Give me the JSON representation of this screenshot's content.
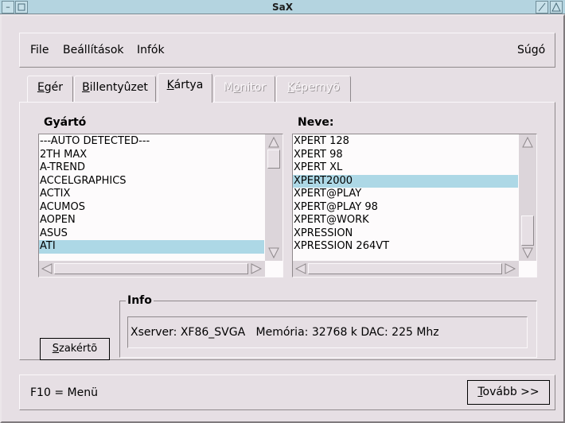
{
  "window": {
    "title": "SaX"
  },
  "menu": {
    "file": "File",
    "settings": "Beállítások",
    "info": "Infók",
    "help": "Súgó"
  },
  "tabs": [
    {
      "label": "Egér",
      "underline": "E",
      "rest": "gér",
      "state": "normal"
    },
    {
      "label": "Billentyûzet",
      "underline": "B",
      "rest": "illentyûzet",
      "state": "normal"
    },
    {
      "label": "Kártya",
      "underline": "K",
      "rest": "ártya",
      "state": "active"
    },
    {
      "label": "Monitor",
      "pre": "M",
      "underline": "o",
      "rest": "nitor",
      "state": "disabled"
    },
    {
      "label": "Képernyõ",
      "underline": "K",
      "rest": "épernyõ",
      "state": "disabled"
    }
  ],
  "manufacturer": {
    "label": "Gyártó",
    "items": [
      "---AUTO DETECTED---",
      "2TH MAX",
      "A-TREND",
      "ACCELGRAPHICS",
      "ACTIX",
      "ACUMOS",
      "AOPEN",
      "ASUS",
      "ATI"
    ],
    "selected": "ATI"
  },
  "name": {
    "label": "Neve:",
    "items": [
      "XPERT 128",
      "XPERT 98",
      "XPERT XL",
      "XPERT2000",
      "XPERT@PLAY",
      "XPERT@PLAY 98",
      "XPERT@WORK",
      "XPRESSION",
      "XPRESSION 264VT"
    ],
    "selected": "XPERT2000"
  },
  "info": {
    "legend": "Info",
    "text": "Xserver: XF86_SVGA   Memória: 32768 k DAC: 225 Mhz"
  },
  "expert_button": {
    "underline": "S",
    "rest": "zakértõ"
  },
  "status": {
    "hint": "F10 = Menü"
  },
  "next_button": {
    "underline": "T",
    "rest": "ovább >>"
  },
  "colors": {
    "background": "#e6dfe4",
    "selection": "#add8e6",
    "titlebar": "#b4d4e0"
  }
}
